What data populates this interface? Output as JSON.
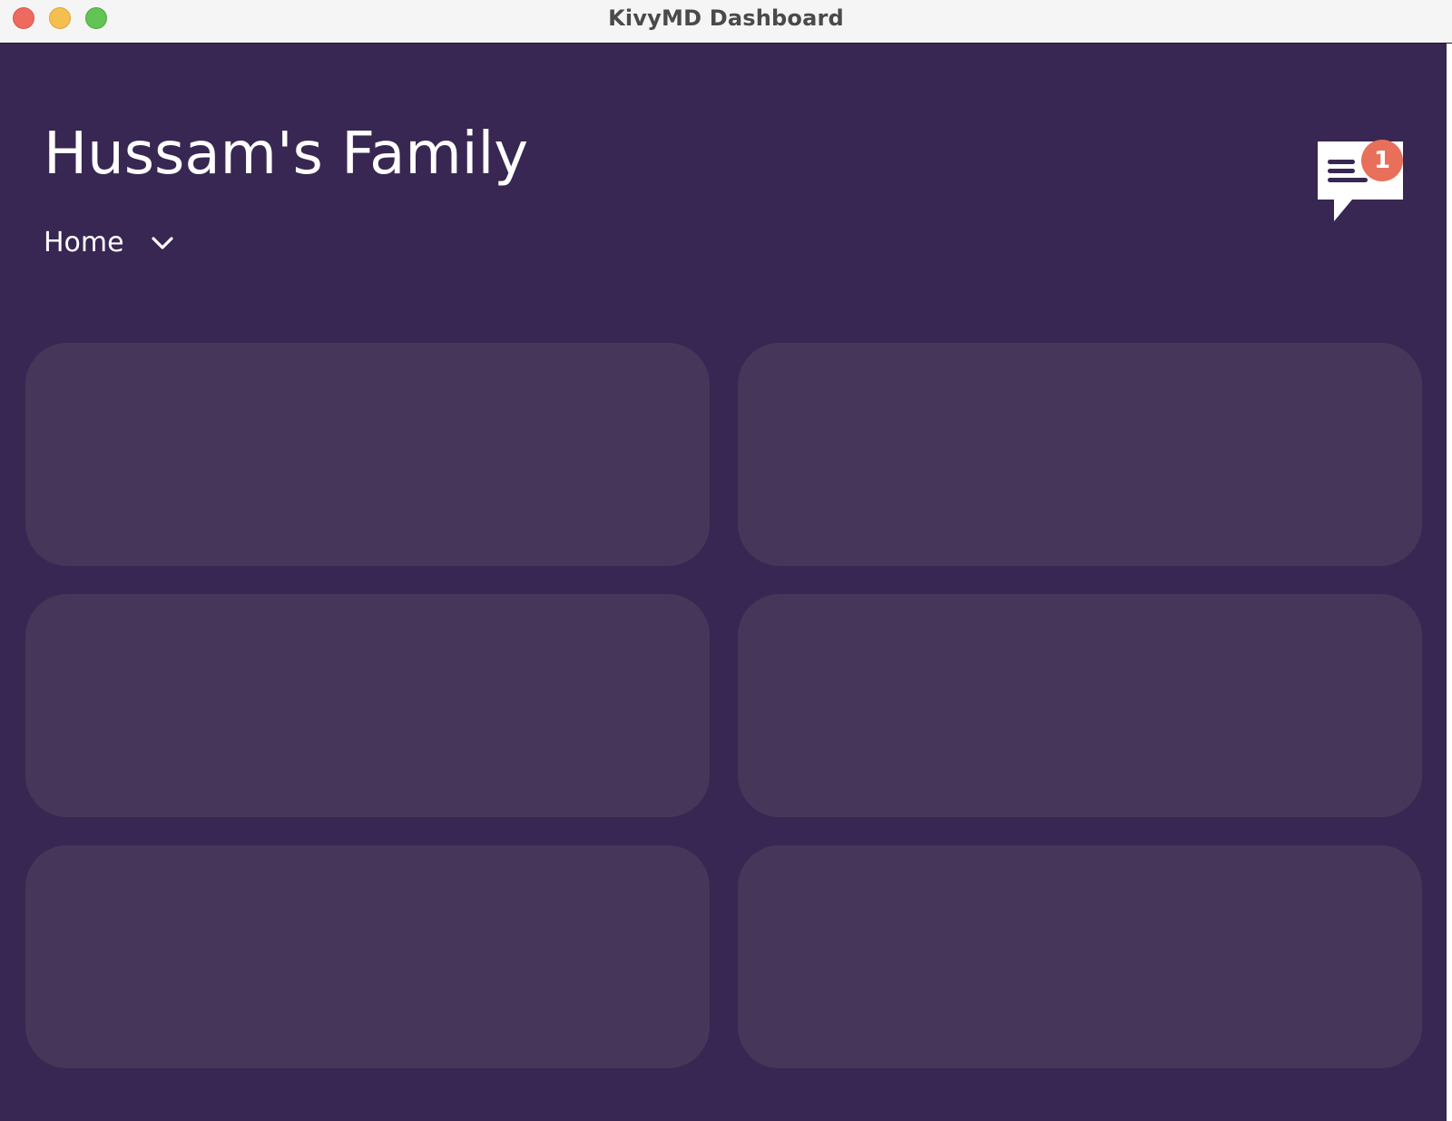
{
  "window": {
    "title": "KivyMD Dashboard"
  },
  "header": {
    "title": "Hussam's Family",
    "location_selector": {
      "label": "Home",
      "icon": "chevron-down-icon"
    }
  },
  "notifications": {
    "icon": "message-icon",
    "count": "1",
    "badge_color": "#e8705a"
  },
  "colors": {
    "background": "#382752",
    "card": "#463659",
    "text": "#ffffff"
  },
  "cards": [
    {
      "id": "card-1"
    },
    {
      "id": "card-2"
    },
    {
      "id": "card-3"
    },
    {
      "id": "card-4"
    },
    {
      "id": "card-5"
    },
    {
      "id": "card-6"
    }
  ]
}
